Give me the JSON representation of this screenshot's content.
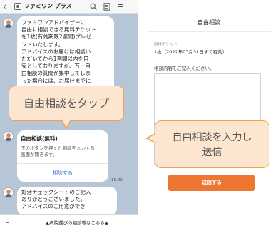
{
  "chat": {
    "header": {
      "back": "‹",
      "title": "ファミワン プラス"
    },
    "messages": {
      "welcome": "ファミワンアドバイザーに\n自由に相談できる無料チケット\nを1枚(有効期限2週間)プレゼ\nントいたします。\nアドバイスのお届けは相談い\nただいてから1週間以内を目\n安としておりますが、万一自\n由相談の質問が集中してしま\nった場合には、お届けまでに",
      "card": {
        "title": "自由相談(無料)",
        "description": "下のボタンを押すと相談を入力する\n画面が開きます。",
        "link": "相談する",
        "time": "18:29"
      },
      "checksheet": "妊活チェックシートのご記入\nありがとうございました。\nアドバイスのご用意ができ"
    },
    "footer": {
      "menu_label": "▲病院選びの相談等はこちら▲"
    },
    "callout": "自由相談をタップ"
  },
  "form": {
    "title": "自由相談",
    "ticket_label": "所持チケット",
    "ticket_value": "1枚（2022年07月31日まで有効）",
    "content_label": "相談内容をご記入ください。",
    "submit_label": "送信する",
    "callout": "自由相談を入力し\n送信"
  },
  "colors": {
    "accent": "#ee7631",
    "callout_fill": "#fce6cf",
    "callout_border": "#f2a24f",
    "chat_background": "#b7c6d6",
    "link": "#2f70c0"
  },
  "icons": [
    "back-icon",
    "logo-icon",
    "search-icon",
    "note-icon",
    "menu-icon",
    "keyboard-icon"
  ]
}
